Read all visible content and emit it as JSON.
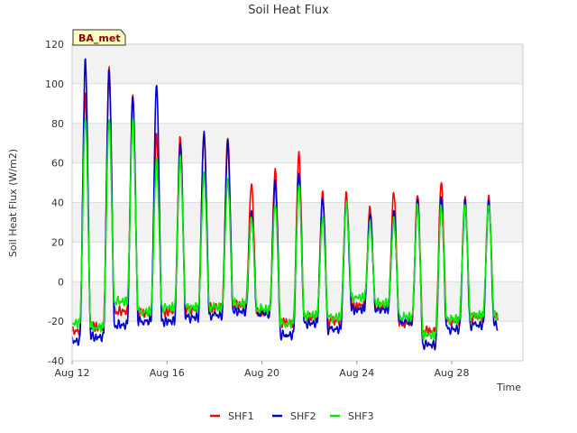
{
  "chart_data": {
    "type": "line",
    "title": "Soil Heat Flux",
    "xlabel": "Time",
    "ylabel": "Soil Heat Flux (W/m2)",
    "badge": "BA_met",
    "ylim": [
      -40,
      120
    ],
    "yticks": [
      -40,
      -20,
      0,
      20,
      40,
      60,
      80,
      100,
      120
    ],
    "xlim": [
      0,
      19
    ],
    "xticks": [
      0,
      4,
      8,
      12,
      16
    ],
    "xtick_labels": [
      "Aug 12",
      "Aug 16",
      "Aug 20",
      "Aug 24",
      "Aug 28"
    ],
    "x_unit": "days since Aug 12 00:00",
    "grid": true,
    "legend_position": "bottom",
    "series": [
      {
        "name": "SHF1",
        "color": "#ff0000",
        "daily_max": [
          95,
          108,
          94,
          75,
          74,
          75,
          74,
          50,
          57,
          65,
          45,
          45,
          38,
          46,
          45,
          51,
          43
        ],
        "daily_min": [
          -25,
          -23,
          -15,
          -16,
          -15,
          -14,
          -13,
          -12,
          -16,
          -21,
          -18,
          -20,
          -12,
          -13,
          -21,
          -25,
          -20,
          -18
        ]
      },
      {
        "name": "SHF2",
        "color": "#0000cc",
        "daily_max": [
          113,
          108,
          95,
          101,
          71,
          76,
          71,
          35,
          51,
          55,
          43,
          41,
          35,
          36,
          41,
          42,
          41
        ],
        "daily_min": [
          -30,
          -28,
          -22,
          -20,
          -20,
          -18,
          -17,
          -15,
          -16,
          -27,
          -21,
          -24,
          -14,
          -14,
          -20,
          -32,
          -24,
          -22
        ]
      },
      {
        "name": "SHF3",
        "color": "#00ee00",
        "daily_max": [
          84,
          83,
          83,
          62,
          63,
          55,
          52,
          33,
          40,
          50,
          33,
          40,
          30,
          32,
          39,
          39,
          40
        ],
        "daily_min": [
          -21,
          -23,
          -10,
          -15,
          -13,
          -13,
          -13,
          -11,
          -14,
          -21,
          -17,
          -18,
          -8,
          -11,
          -18,
          -27,
          -19,
          -17
        ]
      }
    ]
  }
}
